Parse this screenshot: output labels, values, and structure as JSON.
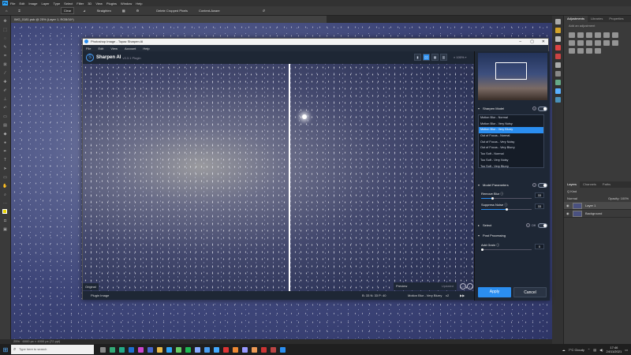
{
  "photoshop": {
    "menus": [
      "File",
      "Edit",
      "Image",
      "Layer",
      "Type",
      "Select",
      "Filter",
      "3D",
      "View",
      "Plugins",
      "Window",
      "Help"
    ],
    "options": [
      "Clear",
      "Straighten",
      "Delete Cropped Pixels",
      "Content-Aware"
    ],
    "doc_tab": "IMG_0181.psb @ 25% (Layer 1, RGB/16*)",
    "status": "25% · 6000 px × 4000 px (72 ppi)"
  },
  "right_panel": {
    "tabs": [
      "Adjustments",
      "Libraries",
      "Properties"
    ],
    "add_adjustment": "Add an adjustment",
    "layer_tabs": [
      "Layers",
      "Channels",
      "Paths"
    ],
    "kind_label": "Q Kind",
    "blend_mode": "Normal",
    "opacity_label": "Opacity: 100%",
    "layers": [
      "Layer 1",
      "Background"
    ]
  },
  "topaz": {
    "window_title": "Photoshop Image - Topaz Sharpen AI",
    "menus": [
      "File",
      "Edit",
      "View",
      "Account",
      "Help"
    ],
    "brand": "Sharpen AI",
    "version": "v3.3.1 Plugin",
    "zoom": "100%",
    "view_buttons": [
      "▮",
      "▯▯",
      "▦",
      "▥"
    ],
    "original_label": "Original",
    "preview_label": "Preview",
    "updated_label": "Updated",
    "bottom_left": "Plugin Image",
    "bottom_stats": "B: 33   N: 33   P: 40",
    "bottom_model": "Motion Blur - Very Blurry",
    "bottom_ver": "v2",
    "sections": {
      "model": "Sharpen Model",
      "params": "Model Parameters",
      "select": "Select",
      "select_state": "Off",
      "post": "Post Processing"
    },
    "models": [
      "Motion Blur - Normal",
      "Motion Blur - Very Noisy",
      "Motion Blur - Very Blurry",
      "Out of Focus - Normal",
      "Out of Focus - Very Noisy",
      "Out of Focus - Very Blurry",
      "Too Soft - Normal",
      "Too Soft - Very Noisy",
      "Too Soft - Very Blurry"
    ],
    "selected_model": 2,
    "remove_blur_label": "Remove Blur",
    "remove_blur_value": "33",
    "suppress_noise_label": "Suppress Noise",
    "suppress_noise_value": "33",
    "add_grain_label": "Add Grain",
    "add_grain_value": "0",
    "apply": "Apply",
    "cancel": "Cancel"
  },
  "taskbar": {
    "search": "Type here to search",
    "weather": "7°C  Cloudy",
    "time": "17:46",
    "date": "24/11/2021"
  },
  "colors": {
    "accent": "#2b8ef0",
    "topaz_bg": "#1e2735"
  }
}
